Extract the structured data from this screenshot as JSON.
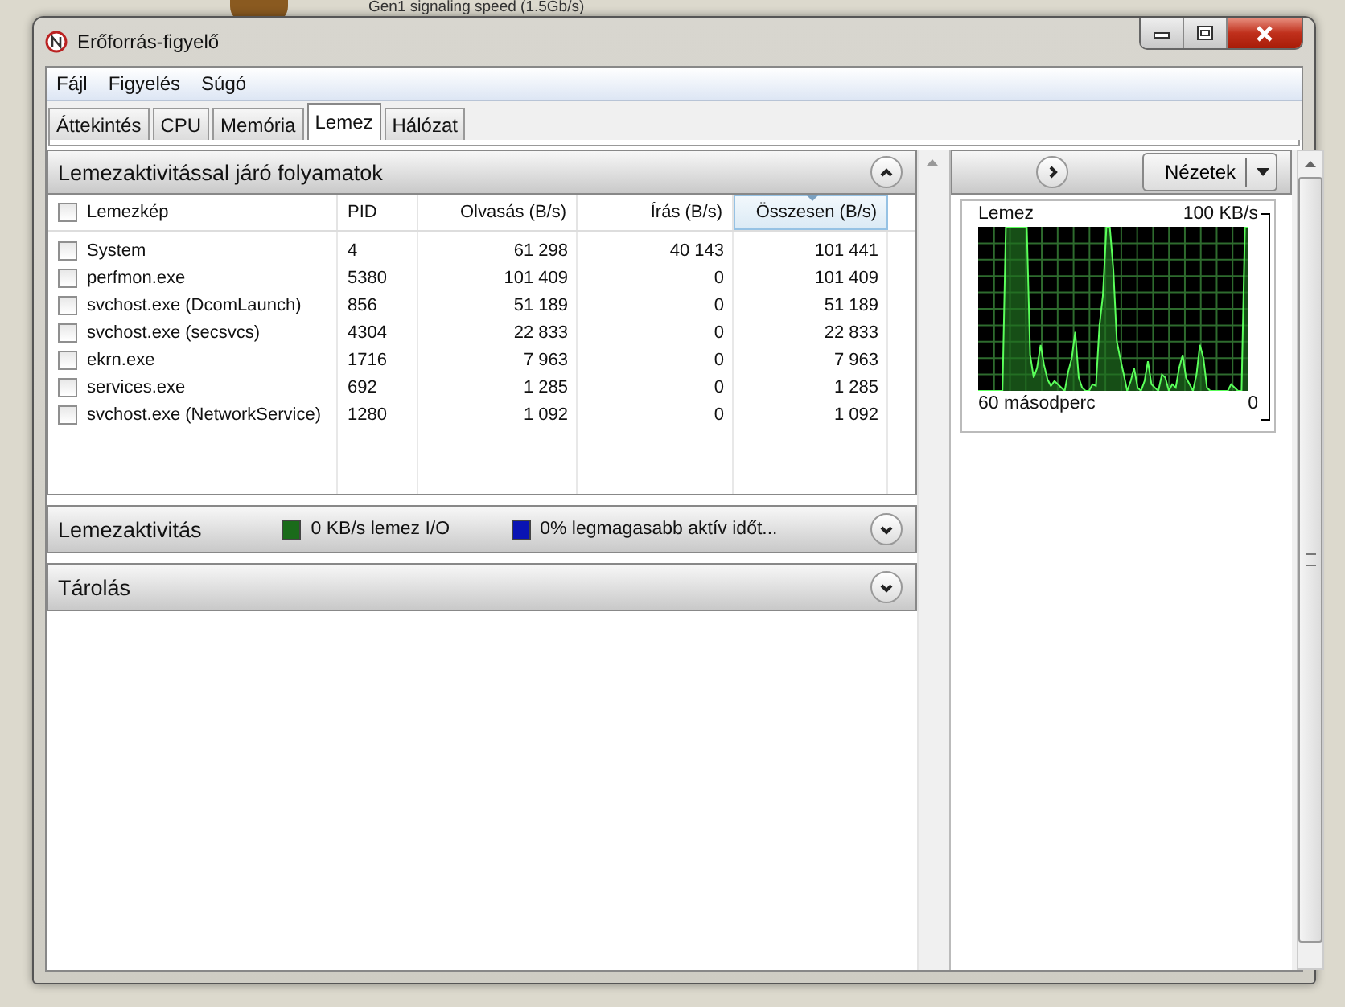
{
  "desktop": {
    "background_text": "Gen1 signaling speed (1.5Gb/s)"
  },
  "window": {
    "title": "Erőforrás-figyelő"
  },
  "menu": [
    "Fájl",
    "Figyelés",
    "Súgó"
  ],
  "tabs": [
    {
      "label": "Áttekintés",
      "selected": false
    },
    {
      "label": "CPU",
      "selected": false
    },
    {
      "label": "Memória",
      "selected": false
    },
    {
      "label": "Lemez",
      "selected": true
    },
    {
      "label": "Hálózat",
      "selected": false
    }
  ],
  "processes": {
    "title": "Lemezaktivitással járó folyamatok",
    "expanded": true,
    "all_checked": false,
    "columns": [
      {
        "label": "Lemezkép",
        "sorted": false
      },
      {
        "label": "PID",
        "sorted": false
      },
      {
        "label": "Olvasás (B/s)",
        "sorted": false
      },
      {
        "label": "Írás (B/s)",
        "sorted": false
      },
      {
        "label": "Összesen (B/s)",
        "sorted": true
      }
    ],
    "rows": [
      {
        "checked": false,
        "image": "System",
        "pid": "4",
        "read": "61 298",
        "write": "40 143",
        "total": "101 441"
      },
      {
        "checked": false,
        "image": "perfmon.exe",
        "pid": "5380",
        "read": "101 409",
        "write": "0",
        "total": "101 409"
      },
      {
        "checked": false,
        "image": "svchost.exe (DcomLaunch)",
        "pid": "856",
        "read": "51 189",
        "write": "0",
        "total": "51 189"
      },
      {
        "checked": false,
        "image": "svchost.exe (secsvcs)",
        "pid": "4304",
        "read": "22 833",
        "write": "0",
        "total": "22 833"
      },
      {
        "checked": false,
        "image": "ekrn.exe",
        "pid": "1716",
        "read": "7 963",
        "write": "0",
        "total": "7 963"
      },
      {
        "checked": false,
        "image": "services.exe",
        "pid": "692",
        "read": "1 285",
        "write": "0",
        "total": "1 285"
      },
      {
        "checked": false,
        "image": "svchost.exe (NetworkService)",
        "pid": "1280",
        "read": "1 092",
        "write": "0",
        "total": "1 092"
      }
    ]
  },
  "disk_activity": {
    "title": "Lemezaktivitás",
    "expanded": false,
    "legend": [
      {
        "text": "0 KB/s lemez I/O",
        "color": "#1a6b1a"
      },
      {
        "text": "0% legmagasabb aktív időt...",
        "color": "#0a14b4"
      }
    ]
  },
  "storage": {
    "title": "Tárolás",
    "expanded": false
  },
  "right_panel": {
    "views_button": "Nézetek",
    "graph": {
      "title": "Lemez",
      "max": "100 KB/s",
      "duration": "60 másodperc",
      "min": "0"
    }
  }
}
